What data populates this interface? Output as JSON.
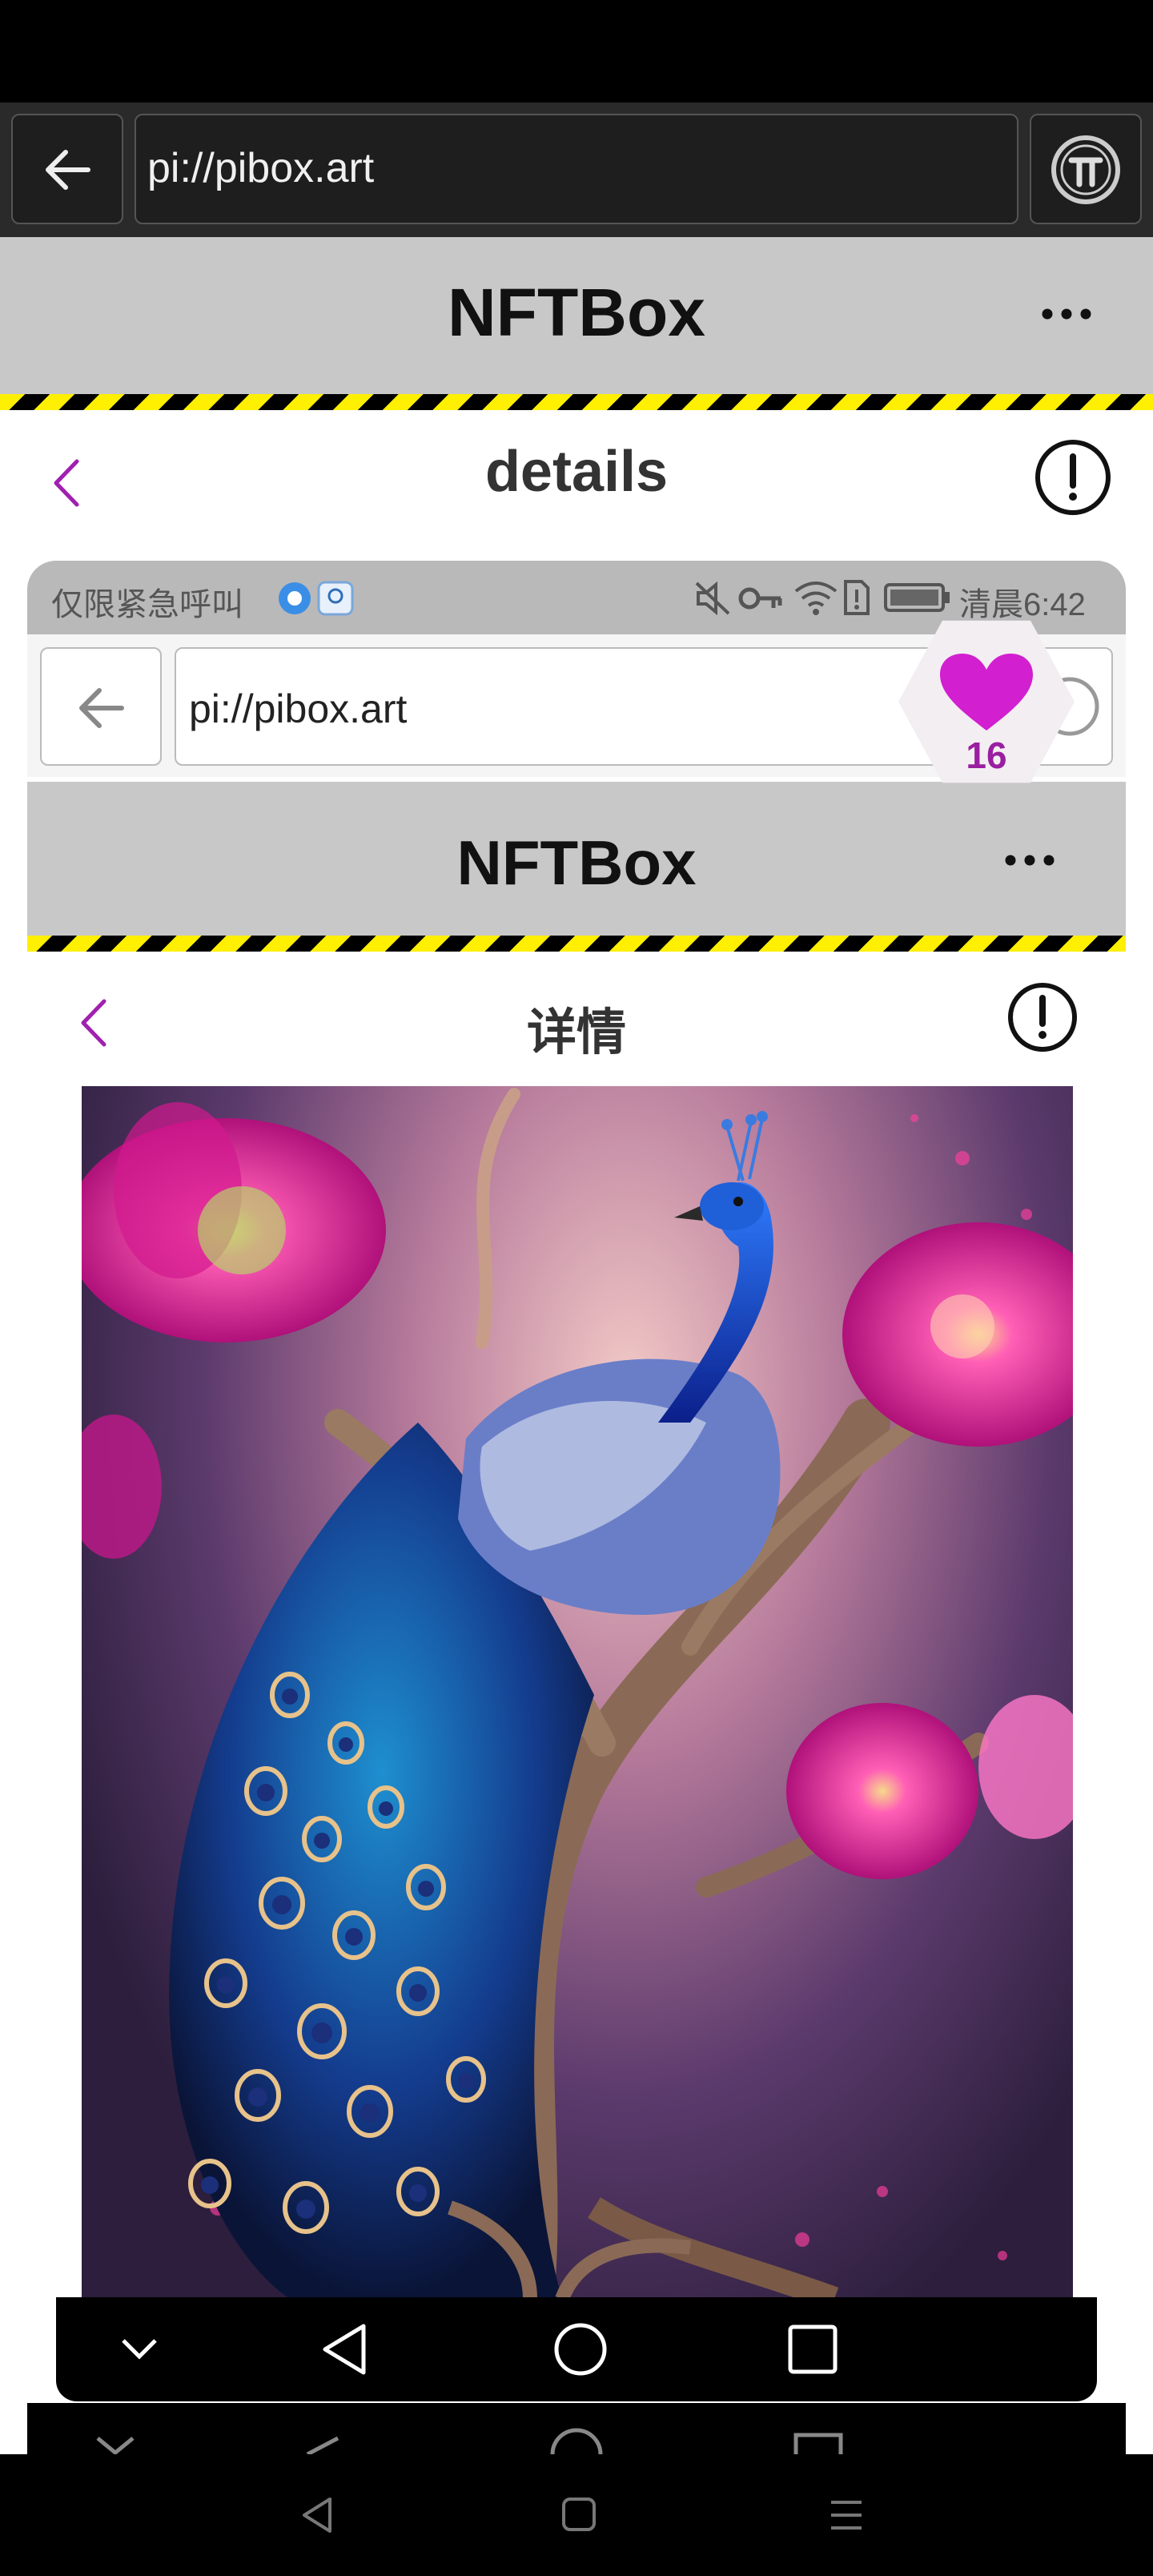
{
  "outer_browser": {
    "url": "pi://pibox.art"
  },
  "outer_app": {
    "title": "NFTBox",
    "more_label": "•••"
  },
  "outer_page": {
    "title": "details"
  },
  "inner_status": {
    "left_text": "仅限紧急呼叫",
    "time": "清晨6:42"
  },
  "inner_browser": {
    "url": "pi://pibox.art"
  },
  "inner_app": {
    "title": "NFTBox",
    "more_label": "•••"
  },
  "inner_page": {
    "title": "详情"
  },
  "like": {
    "count": "16"
  },
  "colors": {
    "accent_purple": "#a020b0",
    "heart": "#d21fd0",
    "header_gray": "#c8c8c8",
    "stripe_yellow": "#ffef00"
  },
  "icons": [
    "back-arrow-icon",
    "pi-logo-icon",
    "more-icon",
    "chevron-left-icon",
    "info-icon",
    "heart-icon",
    "mute-icon",
    "key-icon",
    "wifi-icon",
    "battery-icon",
    "nav-down-icon",
    "nav-back-icon",
    "nav-home-icon",
    "nav-recents-icon",
    "nav-menu-icon"
  ]
}
